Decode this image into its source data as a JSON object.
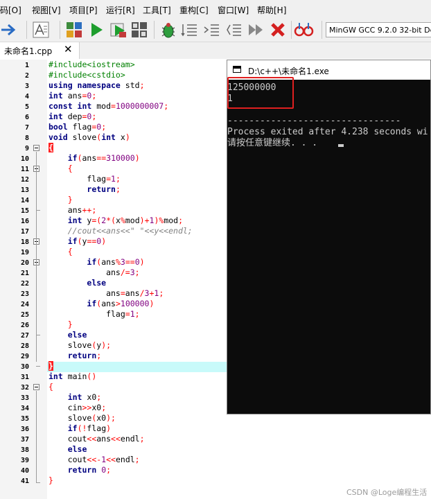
{
  "menu": {
    "items": [
      "码[O]",
      "视图[V]",
      "项目[P]",
      "运行[R]",
      "工具[T]",
      "重构[C]",
      "窗口[W]",
      "帮助[H]"
    ]
  },
  "toolbar": {
    "compiler_select": "MinGW GCC 9.2.0 32-bit Del"
  },
  "tab": {
    "label": "未命名1.cpp",
    "close": "✕"
  },
  "editor": {
    "line_numbers": [
      "1",
      "2",
      "3",
      "4",
      "5",
      "6",
      "7",
      "8",
      "9",
      "10",
      "11",
      "12",
      "13",
      "14",
      "15",
      "16",
      "17",
      "18",
      "19",
      "20",
      "21",
      "22",
      "23",
      "24",
      "25",
      "26",
      "27",
      "28",
      "29",
      "30",
      "31",
      "32",
      "33",
      "34",
      "35",
      "36",
      "37",
      "38",
      "39",
      "40",
      "41"
    ]
  },
  "console": {
    "title": "D:\\c++\\未命名1.exe",
    "output_line1": "125000000",
    "output_line2": "1",
    "separator": "--------------------------------",
    "process_msg": "Process exited after 4.238 seconds wi",
    "press_key": "请按任意键继续. . . "
  },
  "watermark": "CSDN @Loge编程生活",
  "colors": {
    "keyword": "#000080",
    "number": "#800080",
    "preprocessor": "#008000",
    "operator": "#ff0000",
    "comment": "#808080",
    "highlight_line": "#c8fafa",
    "console_bg": "#0c0c0c",
    "annotation_box": "#e02020"
  }
}
